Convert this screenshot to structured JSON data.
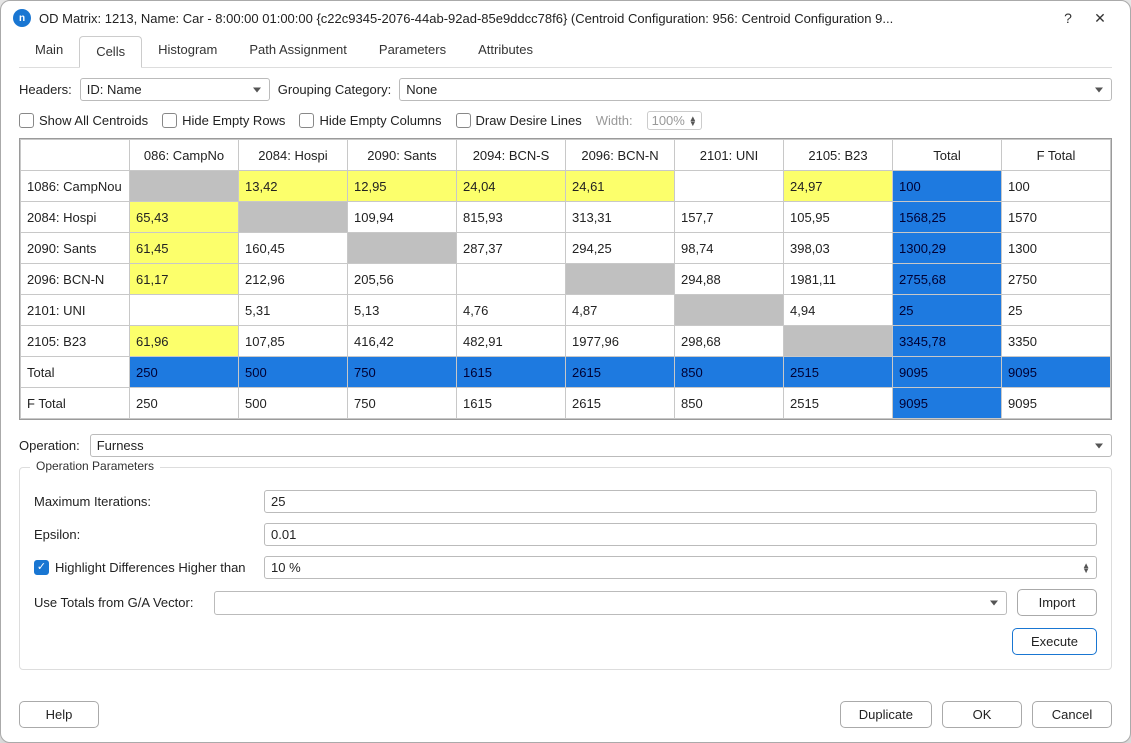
{
  "window": {
    "title": "OD Matrix: 1213, Name: Car - 8:00:00 01:00:00  {c22c9345-2076-44ab-92ad-85e9ddcc78f6} (Centroid Configuration: 956: Centroid Configuration 9...",
    "help_glyph": "?",
    "close_glyph": "✕"
  },
  "tabs": [
    "Main",
    "Cells",
    "Histogram",
    "Path Assignment",
    "Parameters",
    "Attributes"
  ],
  "active_tab": 1,
  "headers": {
    "label": "Headers:",
    "value": "ID: Name"
  },
  "grouping": {
    "label": "Grouping Category:",
    "value": "None"
  },
  "options": {
    "show_all": "Show All Centroids",
    "hide_rows": "Hide Empty Rows",
    "hide_cols": "Hide Empty Columns",
    "draw_lines": "Draw Desire Lines",
    "width_label": "Width:",
    "width_value": "100%"
  },
  "matrix": {
    "col_headers": [
      "086: CampNo",
      "2084: Hospi",
      "2090: Sants",
      "2094: BCN-S",
      "2096: BCN-N",
      "2101: UNI",
      "2105: B23",
      "Total",
      "F Total"
    ],
    "row_headers": [
      "1086: CampNou",
      "2084: Hospi",
      "2090: Sants",
      "2096: BCN-N",
      "2101: UNI",
      "2105: B23",
      "Total",
      "F Total"
    ],
    "cells": [
      [
        {
          "v": "",
          "c": "gray"
        },
        {
          "v": "13,42",
          "c": "yellow"
        },
        {
          "v": "12,95",
          "c": "yellow"
        },
        {
          "v": "24,04",
          "c": "yellow"
        },
        {
          "v": "24,61",
          "c": "yellow"
        },
        {
          "v": "",
          "c": ""
        },
        {
          "v": "24,97",
          "c": "yellow"
        },
        {
          "v": "100",
          "c": "blue"
        },
        {
          "v": "100",
          "c": ""
        }
      ],
      [
        {
          "v": "65,43",
          "c": "yellow"
        },
        {
          "v": "",
          "c": "gray"
        },
        {
          "v": "109,94",
          "c": ""
        },
        {
          "v": "815,93",
          "c": ""
        },
        {
          "v": "313,31",
          "c": ""
        },
        {
          "v": "157,7",
          "c": ""
        },
        {
          "v": "105,95",
          "c": ""
        },
        {
          "v": "1568,25",
          "c": "blue"
        },
        {
          "v": "1570",
          "c": ""
        }
      ],
      [
        {
          "v": "61,45",
          "c": "yellow"
        },
        {
          "v": "160,45",
          "c": ""
        },
        {
          "v": "",
          "c": "gray"
        },
        {
          "v": "287,37",
          "c": ""
        },
        {
          "v": "294,25",
          "c": ""
        },
        {
          "v": "98,74",
          "c": ""
        },
        {
          "v": "398,03",
          "c": ""
        },
        {
          "v": "1300,29",
          "c": "blue"
        },
        {
          "v": "1300",
          "c": ""
        }
      ],
      [
        {
          "v": "61,17",
          "c": "yellow"
        },
        {
          "v": "212,96",
          "c": ""
        },
        {
          "v": "205,56",
          "c": ""
        },
        {
          "v": "",
          "c": ""
        },
        {
          "v": "",
          "c": "gray"
        },
        {
          "v": "294,88",
          "c": ""
        },
        {
          "v": "1981,11",
          "c": ""
        },
        {
          "v": "2755,68",
          "c": "blue"
        },
        {
          "v": "2750",
          "c": ""
        }
      ],
      [
        {
          "v": "",
          "c": ""
        },
        {
          "v": "5,31",
          "c": ""
        },
        {
          "v": "5,13",
          "c": ""
        },
        {
          "v": "4,76",
          "c": ""
        },
        {
          "v": "4,87",
          "c": ""
        },
        {
          "v": "",
          "c": "gray"
        },
        {
          "v": "4,94",
          "c": ""
        },
        {
          "v": "25",
          "c": "blue"
        },
        {
          "v": "25",
          "c": ""
        }
      ],
      [
        {
          "v": "61,96",
          "c": "yellow"
        },
        {
          "v": "107,85",
          "c": ""
        },
        {
          "v": "416,42",
          "c": ""
        },
        {
          "v": "482,91",
          "c": ""
        },
        {
          "v": "1977,96",
          "c": ""
        },
        {
          "v": "298,68",
          "c": ""
        },
        {
          "v": "",
          "c": "gray"
        },
        {
          "v": "3345,78",
          "c": "blue"
        },
        {
          "v": "3350",
          "c": ""
        }
      ],
      [
        {
          "v": "250",
          "c": "blue"
        },
        {
          "v": "500",
          "c": "blue"
        },
        {
          "v": "750",
          "c": "blue"
        },
        {
          "v": "1615",
          "c": "blue"
        },
        {
          "v": "2615",
          "c": "blue"
        },
        {
          "v": "850",
          "c": "blue"
        },
        {
          "v": "2515",
          "c": "blue"
        },
        {
          "v": "9095",
          "c": "blue"
        },
        {
          "v": "9095",
          "c": "blue"
        }
      ],
      [
        {
          "v": "250",
          "c": ""
        },
        {
          "v": "500",
          "c": ""
        },
        {
          "v": "750",
          "c": ""
        },
        {
          "v": "1615",
          "c": ""
        },
        {
          "v": "2615",
          "c": ""
        },
        {
          "v": "850",
          "c": ""
        },
        {
          "v": "2515",
          "c": ""
        },
        {
          "v": "9095",
          "c": "blue"
        },
        {
          "v": "9095",
          "c": ""
        }
      ]
    ]
  },
  "operation": {
    "label": "Operation:",
    "value": "Furness"
  },
  "params": {
    "legend": "Operation Parameters",
    "max_iter_label": "Maximum Iterations:",
    "max_iter": "25",
    "epsilon_label": "Epsilon:",
    "epsilon": "0.01",
    "highlight_label": "Highlight Differences Higher than",
    "highlight_checked": true,
    "highlight_value": "10 %",
    "vector_label": "Use Totals from G/A Vector:",
    "vector_value": "",
    "import_btn": "Import",
    "execute_btn": "Execute"
  },
  "footer": {
    "help": "Help",
    "duplicate": "Duplicate",
    "ok": "OK",
    "cancel": "Cancel"
  }
}
